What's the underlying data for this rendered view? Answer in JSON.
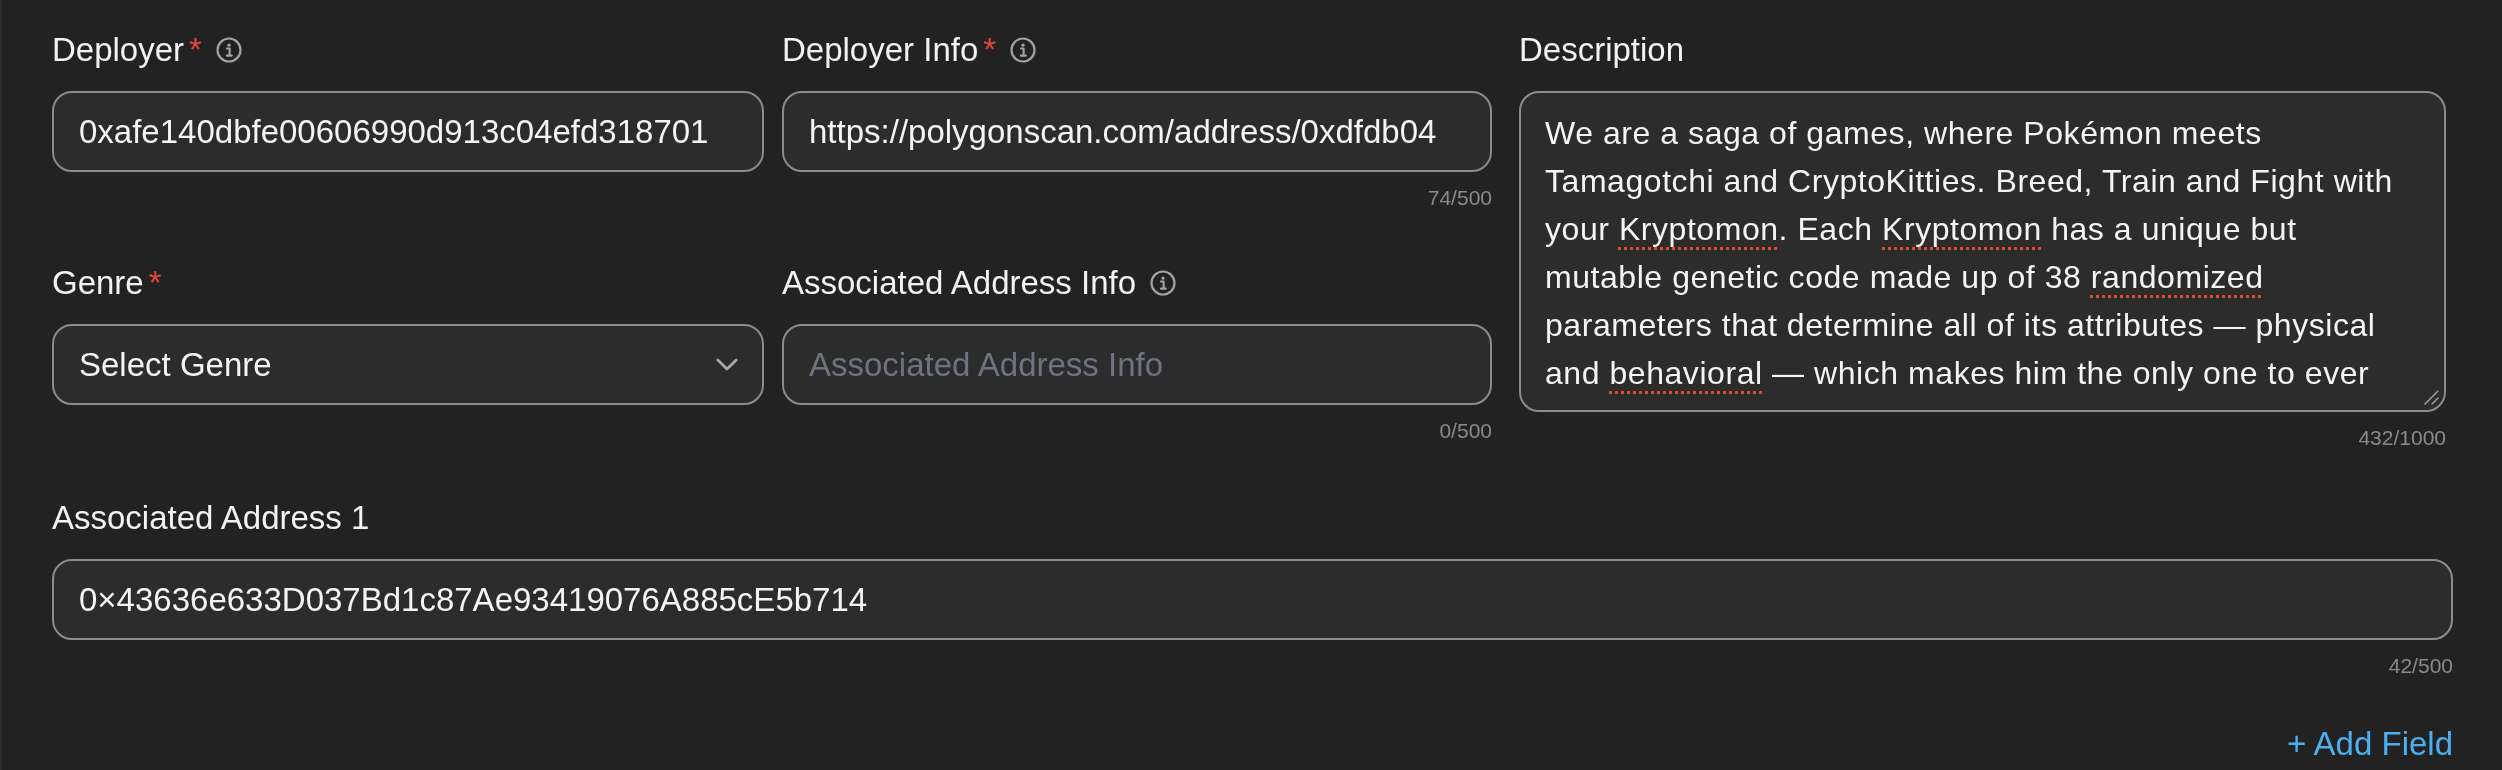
{
  "fields": [
    {
      "kind": "input",
      "label": "Deployer",
      "required_mark": "*",
      "info": true,
      "value": "0xafe140dbfe00606990d913c04efd318701"
    },
    {
      "kind": "input",
      "label": "Deployer Info",
      "required_mark": "*",
      "info": true,
      "value": "https://polygonscan.com/address/0xdfdb04",
      "counter": "74/500"
    },
    {
      "kind": "textarea",
      "label": "Description",
      "lines": [
        {
          "segments": [
            {
              "text": "We are a saga of games, where Pokémon meets",
              "misspelled": false
            }
          ]
        },
        {
          "segments": [
            {
              "text": "Tamagotchi and CryptoKitties. Breed, Train and Fight with",
              "misspelled": false
            }
          ]
        },
        {
          "segments": [
            {
              "text": "your ",
              "misspelled": false
            },
            {
              "text": "Kryptomon",
              "misspelled": true
            },
            {
              "text": ". Each ",
              "misspelled": false
            },
            {
              "text": "Kryptomon",
              "misspelled": true
            },
            {
              "text": " has a unique but",
              "misspelled": false
            }
          ]
        },
        {
          "segments": [
            {
              "text": "mutable genetic code made up of 38 ",
              "misspelled": false
            },
            {
              "text": "randomized",
              "misspelled": true
            }
          ]
        },
        {
          "segments": [
            {
              "text": "parameters that determine all of its attributes — physical",
              "misspelled": false
            }
          ]
        },
        {
          "segments": [
            {
              "text": "and ",
              "misspelled": false
            },
            {
              "text": "behavioral",
              "misspelled": true
            },
            {
              "text": " — which makes him the only one to ever",
              "misspelled": false
            }
          ]
        }
      ],
      "counter": "432/1000"
    },
    {
      "kind": "select",
      "label": "Genre",
      "required_mark": "*",
      "placeholder": "Select Genre"
    },
    {
      "kind": "input",
      "label": "Associated Address Info",
      "info": true,
      "placeholder": "Associated Address Info",
      "counter": "0/500"
    }
  ],
  "associated_addresses": [
    {
      "label": "Associated Address 1",
      "value": "0×43636e633D037Bd1c87Ae93419076A885cE5b714",
      "counter": "42/500"
    }
  ],
  "add_field_button": {
    "label": "+ Add Field"
  }
}
